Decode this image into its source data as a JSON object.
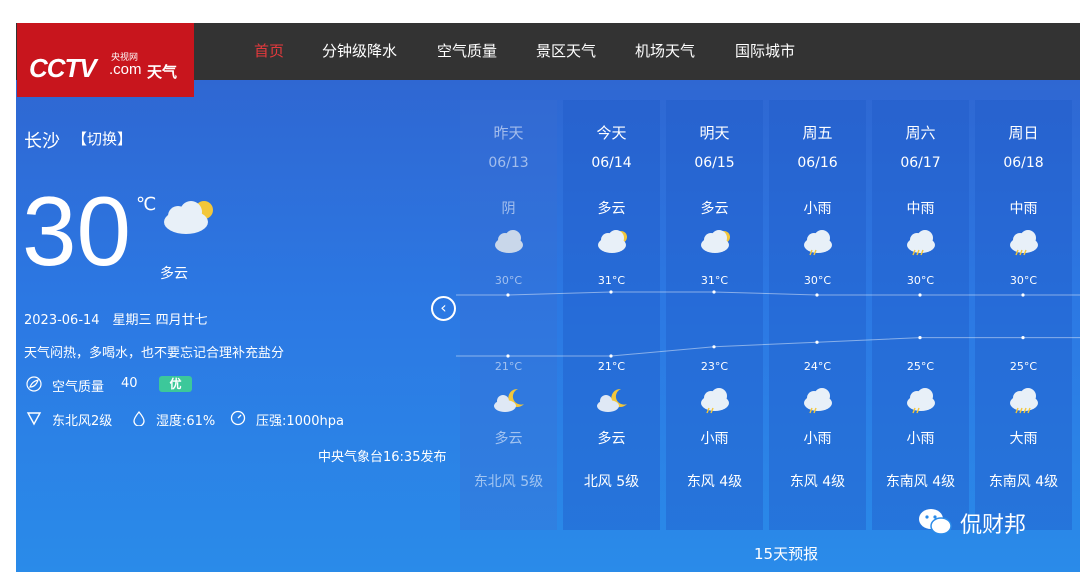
{
  "logo": {
    "brand": "CCTV",
    "site": "央视网",
    "com": ".com",
    "product": "天气"
  },
  "nav": [
    {
      "label": "首页",
      "active": true
    },
    {
      "label": "分钟级降水"
    },
    {
      "label": "空气质量"
    },
    {
      "label": "景区天气"
    },
    {
      "label": "机场天气"
    },
    {
      "label": "国际城市"
    }
  ],
  "current": {
    "city": "长沙",
    "switch_label": "【切换】",
    "temp": "30",
    "unit": "℃",
    "desc": "多云",
    "date": "2023-06-14　星期三 四月廿七",
    "tip": "天气闷热，多喝水，也不要忘记合理补充盐分",
    "aqi_label": "空气质量",
    "aqi_value": "40",
    "aqi_level": "优",
    "wind": "东北风2级",
    "humidity": "湿度:61%",
    "pressure": "压强:1000hpa",
    "publish": "中央气象台16:35发布"
  },
  "days": [
    {
      "day": "昨天",
      "date": "06/13",
      "day_weather": "阴",
      "day_icon": "overcast-icon",
      "high": "30°C",
      "low": "21°C",
      "night_icon": "cloudy-night-icon",
      "night_weather": "多云",
      "wind": "东北风 5级"
    },
    {
      "day": "今天",
      "date": "06/14",
      "day_weather": "多云",
      "day_icon": "partly-cloudy-icon",
      "high": "31°C",
      "low": "21°C",
      "night_icon": "cloudy-night-icon",
      "night_weather": "多云",
      "wind": "北风 5级"
    },
    {
      "day": "明天",
      "date": "06/15",
      "day_weather": "多云",
      "day_icon": "partly-cloudy-icon",
      "high": "31°C",
      "low": "23°C",
      "night_icon": "light-rain-icon",
      "night_weather": "小雨",
      "wind": "东风 4级"
    },
    {
      "day": "周五",
      "date": "06/16",
      "day_weather": "小雨",
      "day_icon": "light-rain-icon",
      "high": "30°C",
      "low": "24°C",
      "night_icon": "light-rain-icon",
      "night_weather": "小雨",
      "wind": "东风 4级"
    },
    {
      "day": "周六",
      "date": "06/17",
      "day_weather": "中雨",
      "day_icon": "moderate-rain-icon",
      "high": "30°C",
      "low": "25°C",
      "night_icon": "light-rain-icon",
      "night_weather": "小雨",
      "wind": "东南风 4级"
    },
    {
      "day": "周日",
      "date": "06/18",
      "day_weather": "中雨",
      "day_icon": "moderate-rain-icon",
      "high": "30°C",
      "low": "25°C",
      "night_icon": "heavy-rain-icon",
      "night_weather": "大雨",
      "wind": "东南风 4级"
    }
  ],
  "forecast15_label": "15天预报",
  "watermark": "侃财邦",
  "colors": {
    "nav_bg": "#333333",
    "logo_bg": "#c8151d",
    "active_nav": "#e4393c",
    "aqi_good": "#3cc89a"
  }
}
